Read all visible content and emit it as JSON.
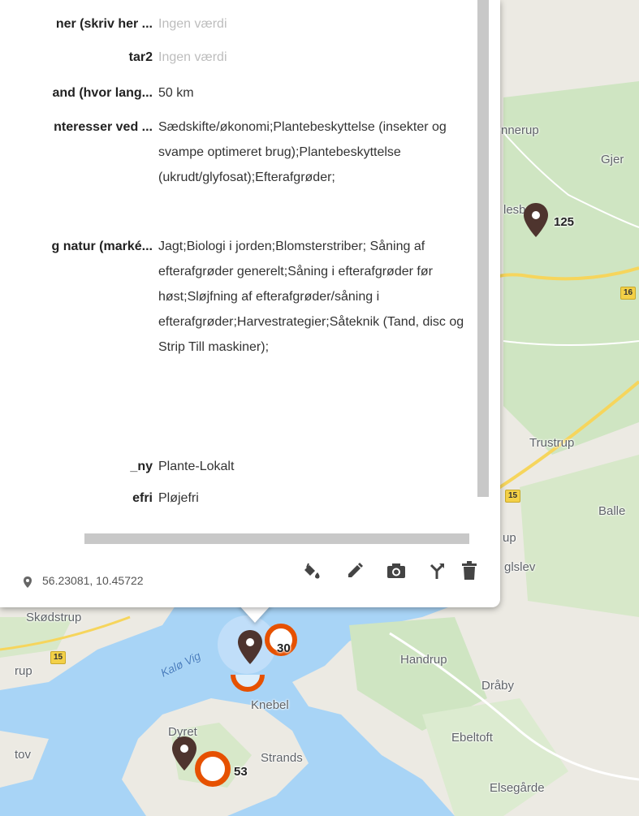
{
  "popup": {
    "attributes": [
      {
        "key": "ner (skriv her ...",
        "value": "Ingen værdi",
        "empty": true
      },
      {
        "key": "tar2",
        "value": "Ingen værdi",
        "empty": true
      },
      {
        "key": "and (hvor lang...",
        "value": "50 km",
        "empty": false
      },
      {
        "key": "nteresser ved ...",
        "value": "Sædskifte/økonomi;Plantebeskyttelse (insekter og svampe optimeret brug);Plantebeskyttelse (ukrudt/glyfosat);Efterafgrøder;",
        "empty": false
      },
      {
        "key": "g natur (marké...",
        "value": "Jagt;Biologi i jorden;Blomsterstriber; Såning af efterafgrøder generelt;Såning i efterafgrøder før høst;Sløjfning af efterafgrøder/såning i efterafgrøder;Harvestrategier;Såteknik (Tand, disc og Strip Till maskiner);",
        "empty": false
      },
      {
        "key": "_ny",
        "value": "Plante-Lokalt",
        "empty": false
      },
      {
        "key": "efri",
        "value": "Pløjefri",
        "empty": false
      }
    ],
    "coordinates": "56.23081, 10.45722",
    "toolbar_icons": [
      "paint-bucket-icon",
      "pencil-icon",
      "camera-icon",
      "directions-icon",
      "trash-icon"
    ]
  },
  "map": {
    "places": [
      {
        "name": "nnerup"
      },
      {
        "name": "Gjer"
      },
      {
        "name": "lesborg"
      },
      {
        "name": "Trustrup"
      },
      {
        "name": "Balle"
      },
      {
        "name": "up"
      },
      {
        "name": "glslev"
      },
      {
        "name": "Skødstrup"
      },
      {
        "name": "rup"
      },
      {
        "name": "Handrup"
      },
      {
        "name": "Dråby"
      },
      {
        "name": "Knebel"
      },
      {
        "name": "Dyret"
      },
      {
        "name": "Strands"
      },
      {
        "name": "Ebeltoft"
      },
      {
        "name": "tov"
      },
      {
        "name": "Elsegårde"
      }
    ],
    "water_label": "Kalø Vig",
    "road_shields": [
      "16",
      "15",
      "15"
    ],
    "markers": [
      {
        "name": "pin-125",
        "count": "125"
      },
      {
        "name": "pin-30",
        "count": "30"
      },
      {
        "name": "pin-53",
        "count": "53"
      }
    ],
    "colors": {
      "water": "#a8d4f6",
      "land": "#eceae3",
      "green": "#cfe5c2",
      "pin": "#4e342e",
      "ring": "#e65100"
    }
  }
}
